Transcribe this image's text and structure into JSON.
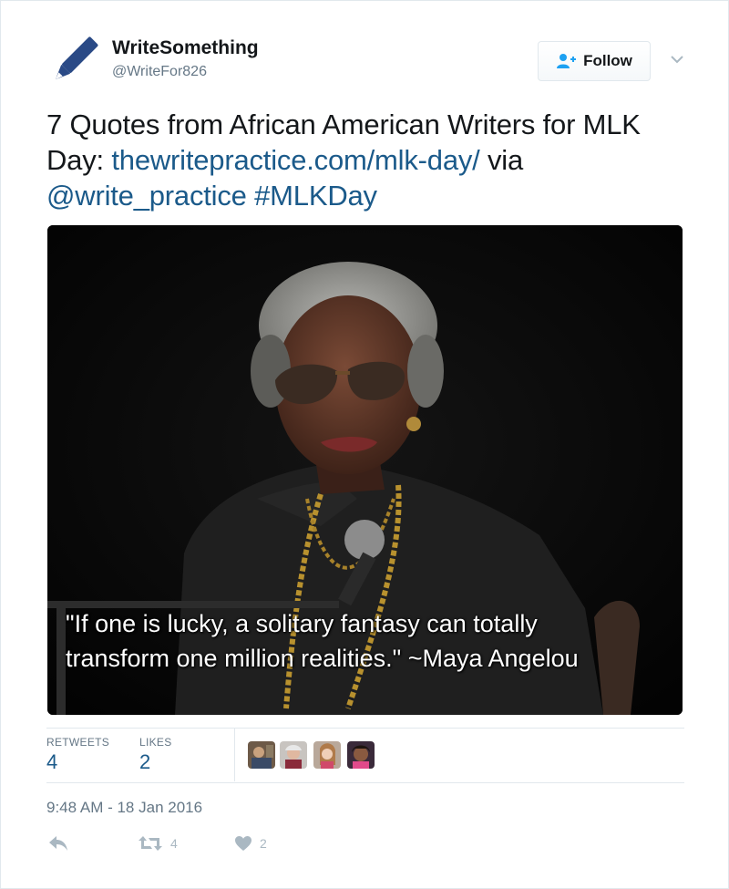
{
  "user": {
    "display_name": "WriteSomething",
    "handle": "@WriteFor826",
    "avatar_icon": "pen-icon"
  },
  "follow_button": {
    "label": "Follow",
    "icon": "add-user-icon"
  },
  "tweet": {
    "text_part1": "7 Quotes from African American Writers for MLK Day: ",
    "link": "thewritepractice.com/mlk-day/",
    "text_part2": " via ",
    "mention": "@write_practice",
    "text_part3": " ",
    "hashtag": "#MLKDay"
  },
  "media": {
    "quote_line1": "\"If one is lucky, a solitary fantasy can totally",
    "quote_line2": "transform one million realities.\" ~Maya Angelou"
  },
  "stats": {
    "retweets_label": "RETWEETS",
    "retweets_value": "4",
    "likes_label": "LIKES",
    "likes_value": "2"
  },
  "timestamp": "9:48 AM - 18 Jan 2016",
  "actions": {
    "reply_icon": "reply-icon",
    "retweet_icon": "retweet-icon",
    "retweet_count": "4",
    "like_icon": "heart-icon",
    "like_count": "2"
  },
  "colors": {
    "link": "#1b5a8a",
    "muted": "#657786",
    "icon_gray": "#aab8c2",
    "follow_accent": "#1da1f2"
  }
}
